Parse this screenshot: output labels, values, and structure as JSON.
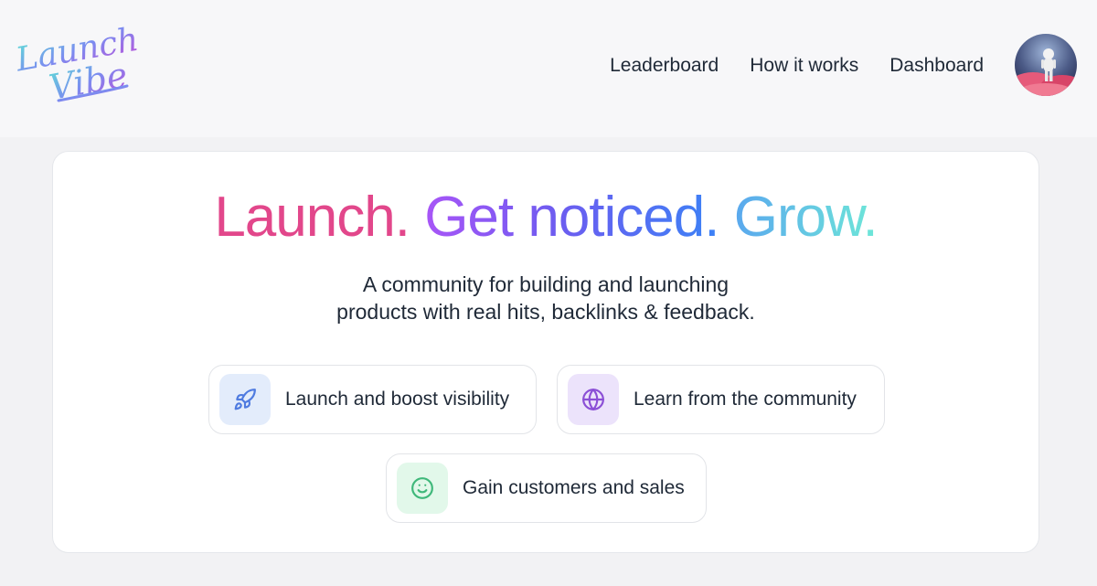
{
  "brand": {
    "logo_line1": "Launch",
    "logo_line2": "Vibe"
  },
  "nav": {
    "items": [
      {
        "label": "Leaderboard"
      },
      {
        "label": "How it works"
      },
      {
        "label": "Dashboard"
      }
    ]
  },
  "hero": {
    "headline_part1": "Launch.",
    "headline_part2": "Get noticed.",
    "headline_part3": "Grow.",
    "subtitle_line1": "A community for building and launching",
    "subtitle_line2": "products with real hits, backlinks & feedback."
  },
  "features": [
    {
      "label": "Launch and boost visibility",
      "icon": "rocket-icon",
      "color": "#4f7be0",
      "bg": "#e3ecfb"
    },
    {
      "label": "Learn from the community",
      "icon": "globe-icon",
      "color": "#8b4fd6",
      "bg": "#ece3fb"
    },
    {
      "label": "Gain customers and sales",
      "icon": "smile-icon",
      "color": "#3fb87a",
      "bg": "#e2f8ea"
    }
  ],
  "colors": {
    "page_bg": "#f2f2f4",
    "card_bg": "#ffffff",
    "accent_pink": "#e2478b",
    "accent_purple": "#a855f7",
    "accent_blue": "#3b82f6",
    "accent_teal": "#6ee7d8"
  }
}
